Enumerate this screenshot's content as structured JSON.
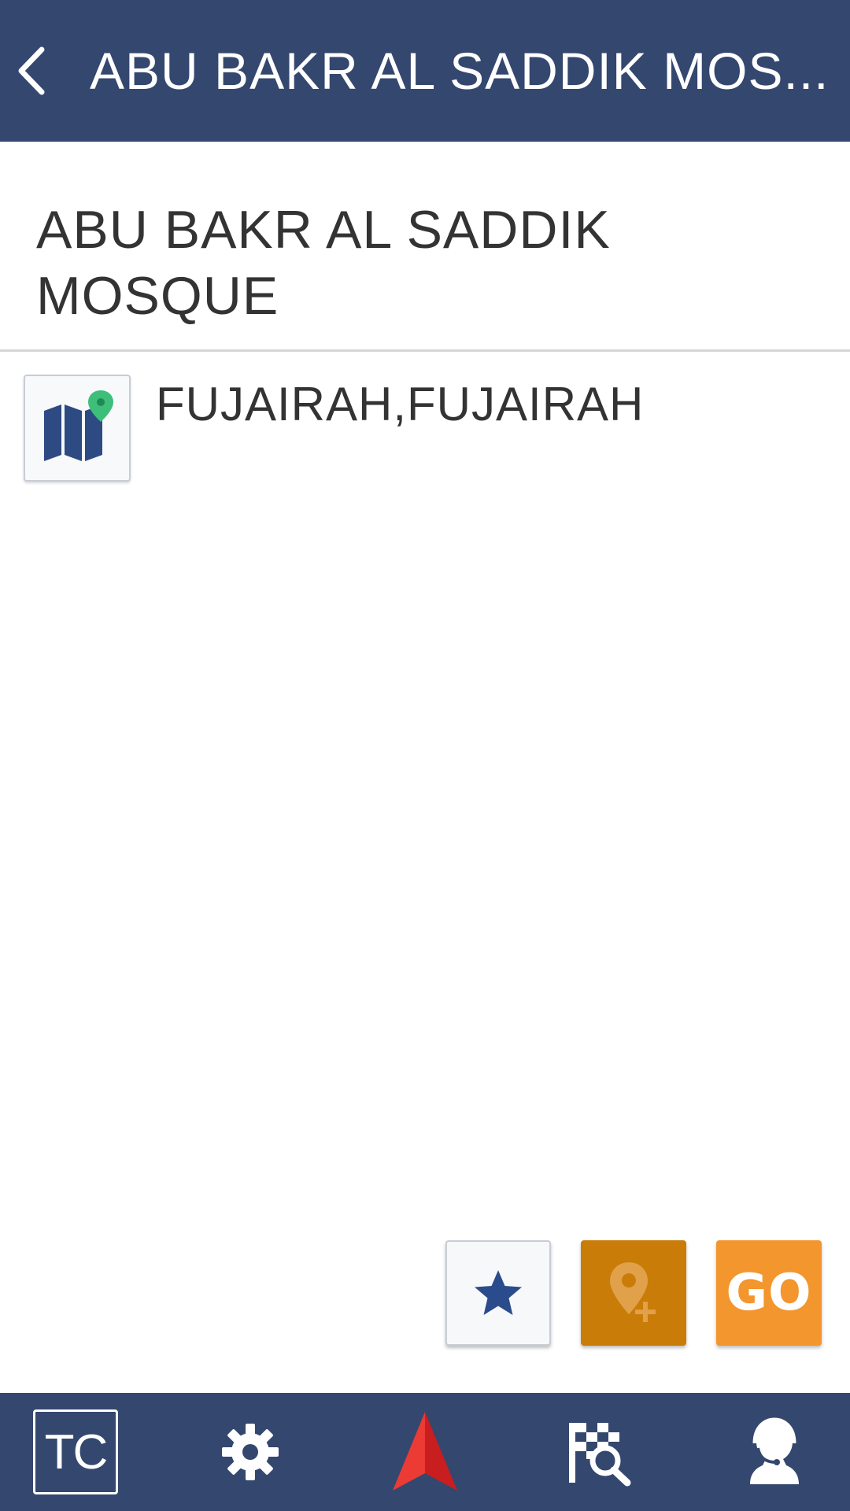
{
  "header": {
    "title": "ABU BAKR AL SADDIK MOS..."
  },
  "place": {
    "name": "ABU BAKR AL SADDIK MOSQUE",
    "address": "FUJAIRAH,FUJAIRAH"
  },
  "actions": {
    "favorite_icon": "star-icon",
    "add_place_icon": "add-location-icon",
    "go_label": "GO"
  },
  "bottom_nav": {
    "tc_label": "TC",
    "items": [
      "tc",
      "settings-icon",
      "navigation-arrow-icon",
      "destination-search-icon",
      "support-agent-icon"
    ]
  },
  "colors": {
    "bar": "#34476e",
    "go": "#f3962e",
    "add_place": "#c97c08",
    "star": "#2b4c8c",
    "nav_arrow": "#e0282a"
  }
}
